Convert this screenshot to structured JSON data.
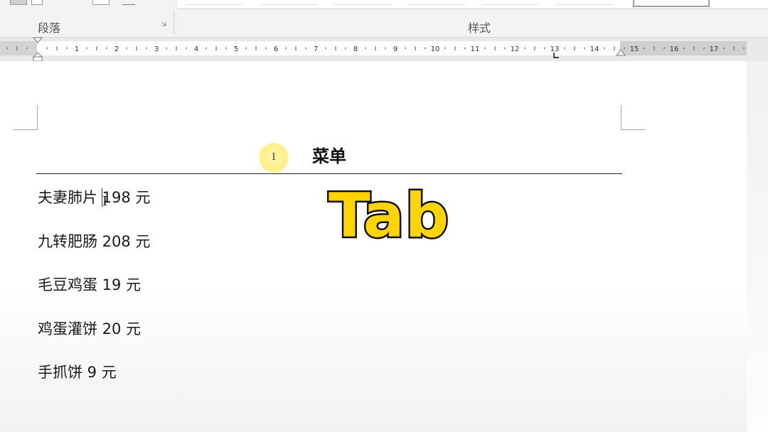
{
  "ribbon": {
    "groups": [
      {
        "label": "段落"
      },
      {
        "label": "样式"
      }
    ]
  },
  "ruler": {
    "numbers": [
      "1",
      "2",
      "3",
      "4",
      "5",
      "6",
      "7",
      "8",
      "9",
      "10",
      "11",
      "12",
      "13",
      "14",
      "15",
      "16",
      "17"
    ]
  },
  "document": {
    "title": "菜单",
    "items": [
      {
        "text": "夫妻肺片 198 元"
      },
      {
        "text": "九转肥肠 208 元"
      },
      {
        "text": "毛豆鸡蛋 19 元"
      },
      {
        "text": "鸡蛋灌饼 20 元"
      },
      {
        "text": "手抓饼 9 元"
      }
    ]
  },
  "overlay": {
    "key_label": "Tab"
  },
  "colors": {
    "overlay_fill": "#ffd400",
    "overlay_stroke": "#111111",
    "cursor_highlight": "#fdf08a"
  }
}
